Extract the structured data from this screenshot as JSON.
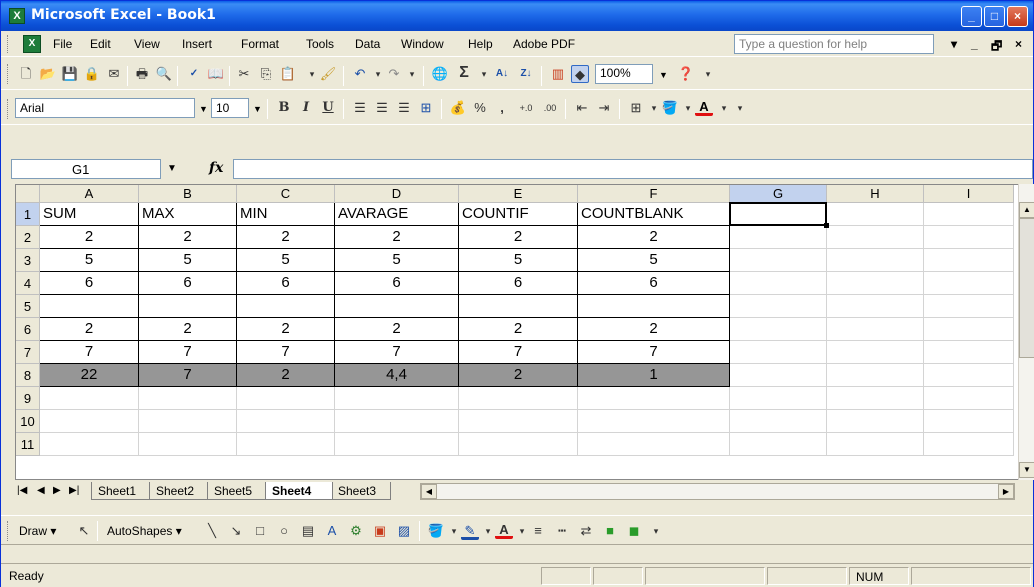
{
  "window": {
    "title": "Microsoft Excel - Book1",
    "app_icon_letter": "X"
  },
  "title_buttons": {
    "minimize": "_",
    "maximize": "□",
    "close": "×"
  },
  "menu": {
    "items": [
      "File",
      "Edit",
      "View",
      "Insert",
      "Format",
      "Tools",
      "Data",
      "Window",
      "Help",
      "Adobe PDF"
    ],
    "help_placeholder": "Type a question for help",
    "mdi_controls": [
      "▾",
      "_",
      "🗗",
      "×"
    ]
  },
  "standard_toolbar": {
    "zoom": "100%",
    "icons": [
      "new-icon",
      "open-icon",
      "save-icon",
      "permission-icon",
      "print-icon",
      "print-preview-icon",
      "spelling-icon",
      "research-icon",
      "cut-icon",
      "copy-icon",
      "paste-icon",
      "format-painter-icon",
      "undo-icon",
      "redo-icon",
      "hyperlink-icon",
      "autosum-icon",
      "sort-asc-icon",
      "sort-desc-icon",
      "chart-wizard-icon",
      "drawing-icon",
      "help-icon"
    ]
  },
  "format_toolbar": {
    "font": "Arial",
    "size": "10",
    "bold": "B",
    "italic": "I",
    "underline": "U",
    "percent": "%",
    "comma": ",",
    "inc_decimal": "+.0",
    "dec_decimal": ".00"
  },
  "formula_bar": {
    "name_box": "G1",
    "fx": "fx",
    "formula": ""
  },
  "grid": {
    "columns": [
      "A",
      "B",
      "C",
      "D",
      "E",
      "F",
      "G",
      "H",
      "I"
    ],
    "rows": [
      "1",
      "2",
      "3",
      "4",
      "5",
      "6",
      "7",
      "8",
      "9",
      "10",
      "11"
    ],
    "selected_column": "G",
    "selected_row": "1",
    "header_row": [
      "SUM",
      "MAX",
      "MIN",
      "AVARAGE",
      "COUNTIF",
      "COUNTBLANK"
    ],
    "data_rows": [
      [
        "2",
        "2",
        "2",
        "2",
        "2",
        "2"
      ],
      [
        "5",
        "5",
        "5",
        "5",
        "5",
        "5"
      ],
      [
        "6",
        "6",
        "6",
        "6",
        "6",
        "6"
      ],
      [
        "",
        "",
        "",
        "",
        "",
        ""
      ],
      [
        "2",
        "2",
        "2",
        "2",
        "2",
        "2"
      ],
      [
        "7",
        "7",
        "7",
        "7",
        "7",
        "7"
      ]
    ],
    "totals_row": [
      "22",
      "7",
      "2",
      "4,4",
      "2",
      "1"
    ]
  },
  "sheets": {
    "tabs": [
      "Sheet1",
      "Sheet2",
      "Sheet5",
      "Sheet4",
      "Sheet3"
    ],
    "active": "Sheet4"
  },
  "draw_toolbar": {
    "draw_label": "Draw ▾",
    "autoshapes_label": "AutoShapes ▾"
  },
  "status": {
    "ready": "Ready",
    "num": "NUM"
  }
}
